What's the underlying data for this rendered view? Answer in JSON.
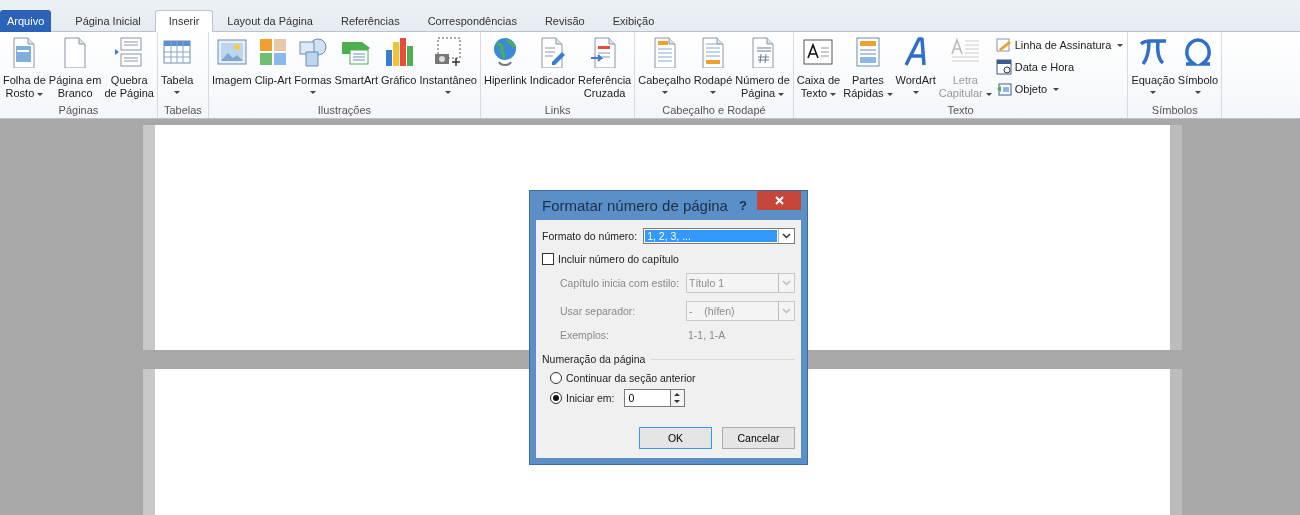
{
  "tabs": [
    {
      "label": "Arquivo",
      "kind": "file",
      "selected": false
    },
    {
      "label": "Página Inicial",
      "kind": "tab",
      "selected": false
    },
    {
      "label": "Inserir",
      "kind": "tab",
      "selected": true
    },
    {
      "label": "Layout da Página",
      "kind": "tab",
      "selected": false
    },
    {
      "label": "Referências",
      "kind": "tab",
      "selected": false
    },
    {
      "label": "Correspondências",
      "kind": "tab",
      "selected": false
    },
    {
      "label": "Revisão",
      "kind": "tab",
      "selected": false
    },
    {
      "label": "Exibição",
      "kind": "tab",
      "selected": false
    }
  ],
  "ribbon": {
    "groups": [
      {
        "label": "Páginas",
        "items": [
          {
            "kind": "menu",
            "lines": [
              "Folha de",
              "Rosto"
            ],
            "disabled": false
          },
          {
            "kind": "button",
            "lines": [
              "Página em",
              "Branco"
            ],
            "disabled": false
          },
          {
            "kind": "button",
            "lines": [
              "Quebra",
              "de Página"
            ],
            "disabled": false
          }
        ]
      },
      {
        "label": "Tabelas",
        "items": [
          {
            "kind": "split",
            "lines": [
              "Tabela"
            ],
            "disabled": false
          }
        ]
      },
      {
        "label": "Ilustrações",
        "items": [
          {
            "kind": "button",
            "lines": [
              "Imagem"
            ],
            "disabled": false
          },
          {
            "kind": "button",
            "lines": [
              "Clip-Art"
            ],
            "disabled": false
          },
          {
            "kind": "split",
            "lines": [
              "Formas"
            ],
            "disabled": false
          },
          {
            "kind": "button",
            "lines": [
              "SmartArt"
            ],
            "disabled": false
          },
          {
            "kind": "button",
            "lines": [
              "Gráfico"
            ],
            "disabled": false
          },
          {
            "kind": "split",
            "lines": [
              "Instantâneo"
            ],
            "disabled": false
          }
        ]
      },
      {
        "label": "Links",
        "items": [
          {
            "kind": "button",
            "lines": [
              "Hiperlink"
            ],
            "disabled": false
          },
          {
            "kind": "button",
            "lines": [
              "Indicador"
            ],
            "disabled": false
          },
          {
            "kind": "button",
            "lines": [
              "Referência",
              "Cruzada"
            ],
            "disabled": false
          }
        ]
      },
      {
        "label": "Cabeçalho e Rodapé",
        "items": [
          {
            "kind": "split",
            "lines": [
              "Cabeçalho"
            ],
            "disabled": false
          },
          {
            "kind": "split",
            "lines": [
              "Rodapé"
            ],
            "disabled": false
          },
          {
            "kind": "menu",
            "lines": [
              "Número de",
              "Página"
            ],
            "disabled": false
          }
        ]
      },
      {
        "label": "Texto",
        "items": [
          {
            "kind": "menu",
            "lines": [
              "Caixa de",
              "Texto"
            ],
            "disabled": false
          },
          {
            "kind": "menu",
            "lines": [
              "Partes",
              "Rápidas"
            ],
            "disabled": false
          },
          {
            "kind": "split",
            "lines": [
              "WordArt"
            ],
            "disabled": false
          },
          {
            "kind": "menu",
            "lines": [
              "Letra",
              "Capitular"
            ],
            "disabled": true
          },
          {
            "kind": "stack",
            "items": [
              {
                "label": "Linha de Assinatura",
                "kind": "menu"
              },
              {
                "label": "Data e Hora",
                "kind": "button"
              },
              {
                "label": "Objeto",
                "kind": "menu"
              }
            ]
          }
        ]
      },
      {
        "label": "Símbolos",
        "items": [
          {
            "kind": "split",
            "lines": [
              "Equação"
            ],
            "disabled": false
          },
          {
            "kind": "split",
            "lines": [
              "Símbolo"
            ],
            "disabled": false
          }
        ]
      }
    ]
  },
  "dialog": {
    "title": "Formatar número de página",
    "help": "?",
    "format": {
      "label": "Formato do número:",
      "value": "1, 2, 3, ..."
    },
    "include_chapter": {
      "label": "Incluir número do capítulo",
      "checked": false
    },
    "chapter_style": {
      "label": "Capítulo inicia com estilo:",
      "value": "Título 1",
      "disabled": true
    },
    "separator": {
      "label": "Usar separador:",
      "value": "-    (hífen)",
      "disabled": true
    },
    "examples": {
      "label": "Exemplos:",
      "value": "1-1, 1-A",
      "disabled": true
    },
    "numbering": {
      "title": "Numeração da página",
      "options": [
        {
          "label": "Continuar da seção anterior",
          "selected": false
        },
        {
          "label": "Iniciar em:",
          "selected": true
        }
      ],
      "start_value": "0"
    },
    "buttons": [
      {
        "label": "OK",
        "default": true
      },
      {
        "label": "Cancelar",
        "default": false
      }
    ]
  }
}
